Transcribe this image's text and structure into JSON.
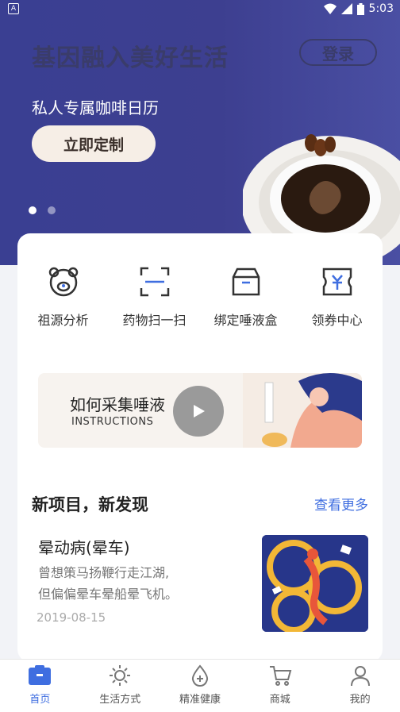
{
  "status_bar": {
    "time": "5:03",
    "left_icon": "A"
  },
  "hero": {
    "title": "基因融入美好生活",
    "login_label": "登录",
    "subtitle": "私人专属咖啡日历",
    "cta_label": "立即定制"
  },
  "quick_actions": [
    {
      "label": "祖源分析",
      "icon": "bear-face-icon"
    },
    {
      "label": "药物扫一扫",
      "icon": "scan-icon"
    },
    {
      "label": "绑定唾液盒",
      "icon": "box-icon"
    },
    {
      "label": "领券中心",
      "icon": "coupon-icon"
    }
  ],
  "banner": {
    "title": "如何采集唾液",
    "subtitle": "INSTRUCTIONS"
  },
  "section": {
    "title": "新项目，新发现",
    "more_label": "查看更多"
  },
  "article": {
    "title": "晕动病(晕车)",
    "desc_line1": "曾想策马扬鞭行走江湖,",
    "desc_line2": "但偏偏晕车晕船晕飞机。",
    "date": "2019-08-15"
  },
  "tabs": [
    {
      "label": "首页",
      "icon": "home-icon",
      "active": true
    },
    {
      "label": "生活方式",
      "icon": "sun-icon",
      "active": false
    },
    {
      "label": "精准健康",
      "icon": "drop-plus-icon",
      "active": false
    },
    {
      "label": "商城",
      "icon": "cart-icon",
      "active": false
    },
    {
      "label": "我的",
      "icon": "user-icon",
      "active": false
    }
  ],
  "colors": {
    "accent": "#3f6ee0",
    "hero_bg": "#3d3f90"
  }
}
